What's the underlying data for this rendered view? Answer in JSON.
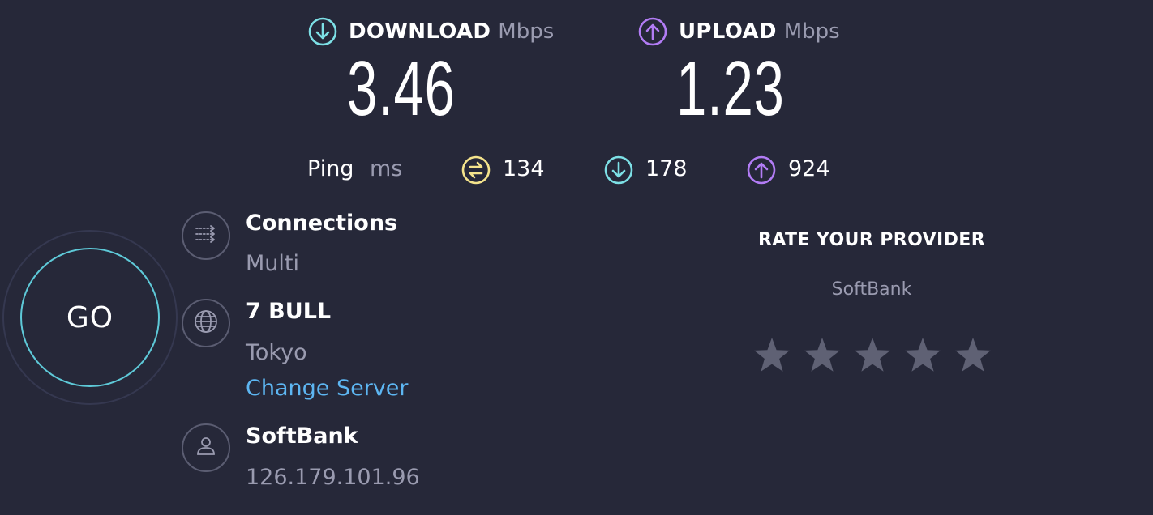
{
  "download": {
    "title": "DOWNLOAD",
    "unit": "Mbps",
    "value": "3.46",
    "icon": "arrow-down-circle-icon",
    "color": "#7de0e6"
  },
  "upload": {
    "title": "UPLOAD",
    "unit": "Mbps",
    "value": "1.23",
    "icon": "arrow-up-circle-icon",
    "color": "#b27cf5"
  },
  "ping": {
    "label": "Ping",
    "unit": "ms",
    "unloaded": {
      "value": "134",
      "icon": "jitter-icon",
      "color": "#f4e38c"
    },
    "download": {
      "value": "178",
      "icon": "arrow-down-circle-icon",
      "color": "#7de0e6"
    },
    "upload": {
      "value": "924",
      "icon": "arrow-up-circle-icon",
      "color": "#b27cf5"
    }
  },
  "go_button": {
    "label": "GO",
    "ring_color": "#5ec9d8"
  },
  "connections": {
    "title": "Connections",
    "value": "Multi",
    "icon": "connections-icon"
  },
  "server": {
    "title": "7 BULL",
    "location": "Tokyo",
    "change_label": "Change Server",
    "icon": "globe-icon"
  },
  "provider": {
    "title": "SoftBank",
    "ip": "126.179.101.96",
    "icon": "user-icon"
  },
  "rating": {
    "title": "RATE YOUR PROVIDER",
    "provider_name": "SoftBank",
    "stars_total": 5,
    "stars_selected": 0,
    "star_color": "#5f6174"
  },
  "theme": {
    "background": "#262839",
    "link_color": "#5db6f2",
    "muted_text": "#9a9bb0"
  }
}
